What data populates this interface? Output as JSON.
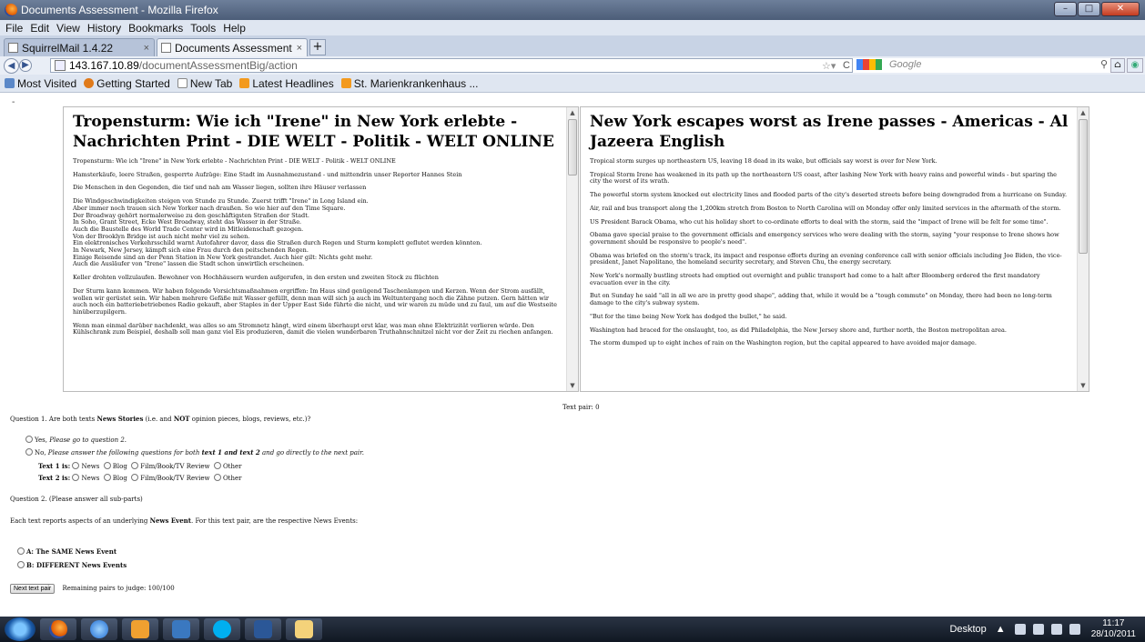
{
  "window": {
    "title": "Documents Assessment - Mozilla Firefox",
    "controls": [
      "–",
      "□",
      "✕"
    ]
  },
  "menu": [
    "File",
    "Edit",
    "View",
    "History",
    "Bookmarks",
    "Tools",
    "Help"
  ],
  "tabs": [
    {
      "label": "SquirrelMail 1.4.22",
      "active": false
    },
    {
      "label": "Documents Assessment",
      "active": true
    }
  ],
  "nav": {
    "url_host": "143.167.10.89",
    "url_path": "/documentAssessmentBig/action",
    "search_placeholder": "Google"
  },
  "bookmarks": [
    "Most Visited",
    "Getting Started",
    "New Tab",
    "Latest Headlines",
    "St. Marienkrankenhaus ..."
  ],
  "page": {
    "dash": "-",
    "left_doc": {
      "title": "Tropensturm: Wie ich \"Irene\" in New York erlebte - Nachrichten Print - DIE WELT - Politik - WELT ONLINE",
      "p1": "Tropensturm: Wie ich \"Irene\" in New York erlebte - Nachrichten Print - DIE WELT - Politik - WELT ONLINE",
      "p2": "Hamsterkäufe, leere Straßen, gesperrte Aufzüge: Eine Stadt im Ausnahmezustand - und mittendrin unser Reporter Hannes Stein",
      "p3": "Die Menschen in den Gegenden, die tief und nah am Wasser liegen, sollten ihre Häuser verlassen",
      "lines": [
        "Die Windgeschwindigkeiten steigen von Stunde zu Stunde. Zuerst trifft \"Irene\" in Long Island ein.",
        "Aber immer noch trauen sich New Yorker nach draußen. So wie hier auf den Time Square.",
        "Der Broadway gehört normalerweise zu den geschäftigsten Straßen der Stadt.",
        "In Soho, Grant Street, Ecke West Broadway, steht das Wasser in der Straße.",
        "Auch die Baustelle des World Trade Center wird in Mitleidenschaft gezogen.",
        "Von der Brooklyn Bridge ist auch nicht mehr viel zu sehen.",
        "Ein elektronisches Verkehrsschild warnt Autofahrer davor, dass die Straßen durch Regen und Sturm komplett geflutet werden könnten.",
        "In Newark, New Jersey, kämpft sich eine Frau durch den peitschenden Regen.",
        "Einige Reisende sind an der Penn Station in New York gestrandet. Auch hier gilt: Nichts geht mehr.",
        "Auch die Ausläufer von \"Irene\" lassen die Stadt schon unwirtlich erscheinen."
      ],
      "p4": "Keller drohten vollzulaufen. Bewohner von Hochhäusern wurden aufgerufen, in den ersten und zweiten Stock zu flüchten",
      "p5": "Der Sturm kann kommen. Wir haben folgende Vorsichtsmaßnahmen ergriffen: Im Haus sind genügend Taschenlampen und Kerzen. Wenn der Strom ausfällt, wollen wir gerüstet sein. Wir haben mehrere Gefäße mit Wasser gefüllt, denn man will sich ja auch im Weltuntergang noch die Zähne putzen. Gern hätten wir auch noch ein batteriebetriebenes Radio gekauft, aber Staples in der Upper East Side führte die nicht, und wir waren zu müde und zu faul, um auf die Westseite hinüberzupilgern.",
      "p6": "Wenn man einmal darüber nachdenkt, was alles so am Stromnetz hängt, wird einem überhaupt erst klar, was man ohne Elektrizität verlieren würde. Den Kühlschrank zum Beispiel, deshalb soll man ganz viel Eis produzieren, damit die vielen wunderbaren Truthahnschnitzel nicht vor der Zeit zu riechen anfangen."
    },
    "right_doc": {
      "title": "New York escapes worst as Irene passes - Americas - Al Jazeera English",
      "paragraphs": [
        "Tropical storm surges up northeastern US, leaving 18 dead in its wake, but officials say worst is over for New York.",
        "Tropical Storm Irene has weakened in its path up the northeastern US coast, after lashing New York with heavy rains and powerful winds - but sparing the city the worst of its wrath.",
        "The powerful storm system knocked out electricity lines and flooded parts of the city's deserted streets before being downgraded from a hurricane on Sunday.",
        "Air, rail and bus transport along the 1,200km stretch from Boston to North Carolina will on Monday offer only limited services in the aftermath of the storm.",
        "US President Barack Obama, who cut his holiday short to co-ordinate efforts to deal with the storm, said the \"impact of Irene will be felt for some time\".",
        "Obama gave special praise to the government officials and emergency services who were dealing with the storm, saying \"your response to Irene shows how government should be responsive to people's need\".",
        "Obama was briefed on the storm's track, its impact and response efforts during an evening conference call with senior officials including Joe Biden, the vice-president, Janet Napolitano, the homeland security secretary, and Steven Chu, the energy secretary.",
        "New York's normally bustling streets had emptied out overnight and public transport had come to a halt after Bloomberg ordered the first mandatory evacuation ever in the city.",
        "But on Sunday he said \"all in all we are in pretty good shape\", adding that, while it would be a \"tough commute\" on Monday, there had been no long-term damage to the city's subway system.",
        "\"But for the time being New York has dodged the bullet,\" he said.",
        "Washington had braced for the onslaught, too, as did Philadelphia, the New Jersey shore and, further north, the Boston metropolitan area.",
        "The storm dumped up to eight inches of rain on the Washington region, but the capital appeared to have avoided major damage."
      ]
    },
    "text_pair": "Text pair: 0",
    "q1": {
      "prefix": "Question 1.   Are both texts ",
      "bold1": "News Stories",
      "mid": " (i.e. and ",
      "bold2": "NOT",
      "suffix": " opinion pieces, blogs, reviews, etc.)?",
      "yes_label": "Yes, ",
      "yes_note": "Please go to question 2.",
      "no_label": "No, ",
      "no_note_a": "Please answer the following questions for both ",
      "no_note_bold": "text 1 and text 2",
      "no_note_b": " and go directly to the next pair.",
      "text1_label": "Text 1 is:",
      "text2_label": "Text 2 is:",
      "options": [
        "News",
        "Blog",
        "Film/Book/TV Review",
        "Other"
      ]
    },
    "q2": {
      "heading": "Question 2.   (Please answer all sub-parts)",
      "desc_a": "Each text reports aspects of an underlying ",
      "desc_bold": "News Event",
      "desc_b": ". For this text pair, are the respective News Events:",
      "option_a": "A: The SAME News Event",
      "option_b": "B: DIFFERENT News Events"
    },
    "next_button": "Next text pair",
    "remaining": "Remaining pairs to judge:  100/100"
  },
  "taskbar": {
    "desktop_label": "Desktop",
    "time": "11:17",
    "date": "28/10/2011"
  }
}
